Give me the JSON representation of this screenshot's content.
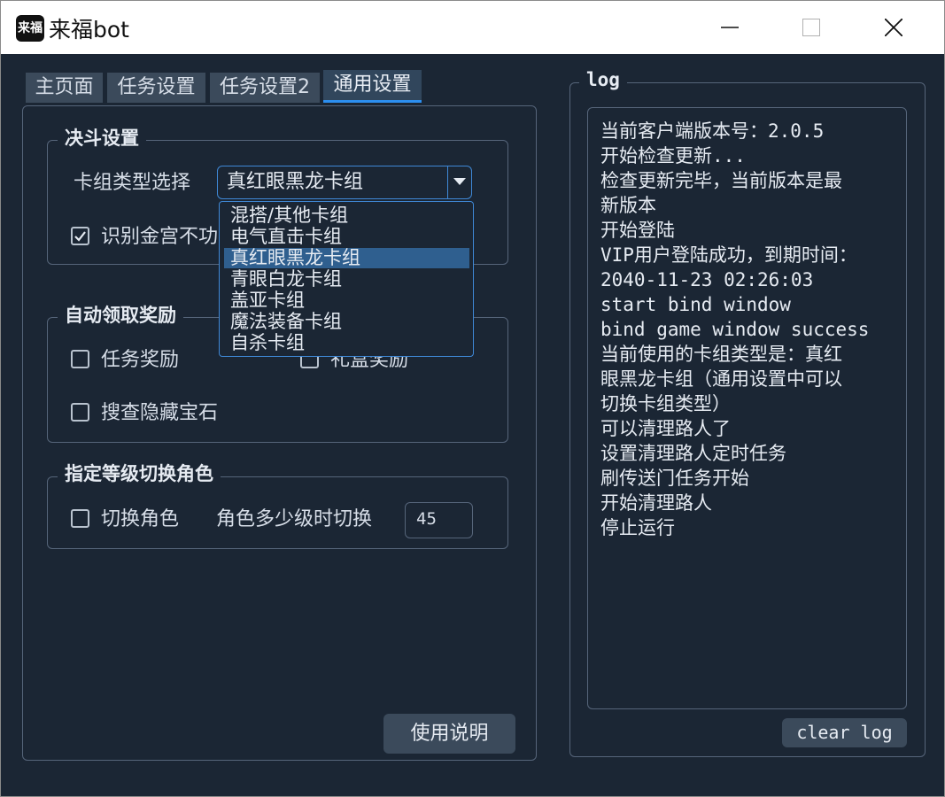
{
  "window": {
    "title": "来福bot",
    "icon_text": "来福"
  },
  "tabs": [
    {
      "label": "主页面"
    },
    {
      "label": "任务设置"
    },
    {
      "label": "任务设置2"
    },
    {
      "label": "通用设置"
    }
  ],
  "duel": {
    "title": "决斗设置",
    "deck_label": "卡组类型选择",
    "deck_selected": "真红眼黑龙卡组",
    "deck_options": [
      "混搭/其他卡组",
      "电气直击卡组",
      "真红眼黑龙卡组",
      "青眼白龙卡组",
      "盖亚卡组",
      "魔法装备卡组",
      "自杀卡组"
    ],
    "recognize_label": "识别金宫不攻击",
    "recognize_visible": "识别金宫不功",
    "recognize_checked": true
  },
  "rewards": {
    "title": "自动领取奖励",
    "task_reward": "任务奖励",
    "gift_reward": "礼盒奖励",
    "search_gems": "搜查隐藏宝石"
  },
  "role": {
    "title": "指定等级切换角色",
    "switch_label": "切换角色",
    "level_label": "角色多少级时切换",
    "level_value": "45"
  },
  "help_button": "使用说明",
  "log": {
    "title": "log",
    "lines": [
      "当前客户端版本号：2.0.5",
      "开始检查更新...",
      "检查更新完毕，当前版本是最",
      "新版本",
      "开始登陆",
      "VIP用户登陆成功，到期时间：",
      "2040-11-23 02:26:03",
      "start bind window",
      "bind game window success",
      "当前使用的卡组类型是：真红",
      "眼黑龙卡组（通用设置中可以",
      "切换卡组类型）",
      "可以清理路人了",
      "设置清理路人定时任务",
      "刷传送门任务开始",
      "开始清理路人",
      "停止运行"
    ],
    "clear_button": "clear log"
  }
}
